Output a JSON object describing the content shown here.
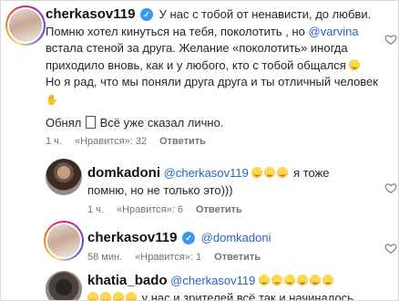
{
  "comments": [
    {
      "username": "cherkasov119",
      "lines": [
        "У нас с тобой от ненависти, до любви.",
        "Помню хотел кинуться на тебя, поколотить , но ",
        "встала стеной за друга. Желание «поколотить» иногда",
        "приходило вновь, как и у любого, кто с тобой общался",
        "Но я рад, что мы поняли друга друга и ты отличный человек",
        "Обнял",
        "Всё уже сказал лично."
      ],
      "mention": "@varvina",
      "time": "1 ч.",
      "likes": "«Нравится»: 32",
      "reply": "Ответить"
    },
    {
      "username": "domkadoni",
      "mention": "@cherkasov119",
      "lines": [
        "я тоже",
        "помню, но не только это)))"
      ],
      "time": "1 ч.",
      "likes": "«Нравится»: 6",
      "reply": "Ответить"
    },
    {
      "username": "cherkasov119",
      "mention": "@domkadoni",
      "time": "58 мин.",
      "likes": "«Нравится»: 1",
      "reply": "Ответить"
    },
    {
      "username": "khatia_bado",
      "mention": "@cherkasov119",
      "lines": [
        "у нас и зрителей всё так и начиналось"
      ]
    }
  ],
  "icons": {
    "verified": "verified-badge-icon",
    "like": "heart-outline-icon",
    "emoji": "grinning-face-emoji",
    "hand": "waving-hand-emoji"
  },
  "colors": {
    "mention": "#2b63c7",
    "meta": "#737373",
    "verified": "#3897f0"
  }
}
